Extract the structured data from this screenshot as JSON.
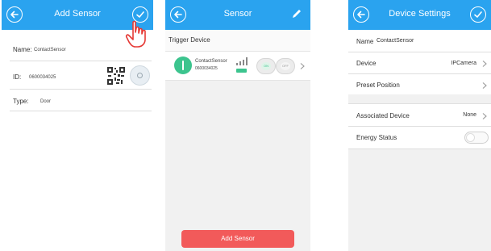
{
  "add_sensor": {
    "title": "Add Sensor",
    "name_label": "Name:",
    "name_value": "ContactSensor",
    "id_label": "ID:",
    "id_value": "0600034025",
    "type_label": "Type:",
    "type_value": "Door"
  },
  "sensor": {
    "title": "Sensor",
    "section_title": "Trigger Device",
    "device_name": "ContactSensor",
    "device_id": "0600034025",
    "btn_on": "ON",
    "btn_off": "OFF",
    "add_button": "Add Sensor"
  },
  "device_settings": {
    "title": "Device Settings",
    "name_label": "Name",
    "name_value": "ContactSensor",
    "device_label": "Device",
    "device_value": "IPCamera",
    "preset_label": "Preset Position",
    "associated_label": "Associated Device",
    "associated_value": "None",
    "energy_label": "Energy Status"
  },
  "colors": {
    "header": "#2aa3ef",
    "accent_red": "#f25a5a",
    "sensor_green": "#3cc48e"
  }
}
